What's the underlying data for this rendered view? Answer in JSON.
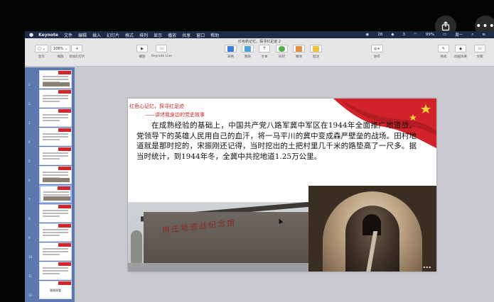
{
  "menubar": {
    "app_name": "Keynote",
    "items": [
      "文件",
      "编辑",
      "插入",
      "幻灯片",
      "格式",
      "排列",
      "显示",
      "播放",
      "共享",
      "窗口",
      "帮助"
    ],
    "status": {
      "count_a": "28",
      "count_b": "3",
      "battery": "99%",
      "user": "周一"
    }
  },
  "window": {
    "title": "红色新记忆，探寻红足迹 2"
  },
  "toolbar": {
    "left": [
      {
        "label": "显示",
        "btn": "▢ ⌄"
      },
      {
        "label": "缩放",
        "btn": "106% ⌄"
      },
      {
        "label": "添加幻灯片",
        "btn": "+"
      }
    ],
    "play": [
      {
        "label": "播放",
        "btn": "▶"
      },
      {
        "label": "Keynote Live",
        "btn": "▭"
      }
    ],
    "insert": [
      {
        "label": "表格",
        "color": "#3b7be0"
      },
      {
        "label": "图表",
        "color": "#4aa3df"
      },
      {
        "label": "文本",
        "btn": "T"
      },
      {
        "label": "形状",
        "color": "#55b04a"
      },
      {
        "label": "媒体",
        "color": "#e0903b"
      },
      {
        "label": "批注",
        "color": "#f2c23a"
      }
    ],
    "collab": {
      "label": "协作"
    },
    "right": [
      {
        "label": "格式"
      },
      {
        "label": "动画效果"
      },
      {
        "label": "文稿"
      }
    ]
  },
  "slide": {
    "title": "红色心记忆，探寻红足迹",
    "subtitle": "——讲述我身边的党史故事",
    "paragraph": "在成熟经验的基础上，中国共产党八路军冀中军区在1944年全面推广地道战。党领导下的英雄人民用自己的血汗，将一马平川的冀中变成森严壁垒的战场。田村地道就是那时挖的，宋振刚还记得，当时挖出的土把村里几千米的路垫高了一尺多。据当时统计，到1944年冬，全冀中共挖地道1.25万公里。",
    "wall_sign": "冉庄地道战纪念馆"
  },
  "sidebar": {
    "slides": [
      {
        "num": "1",
        "type": "image"
      },
      {
        "num": "2",
        "type": "text"
      },
      {
        "num": "3",
        "type": "text"
      },
      {
        "num": "4",
        "type": "text"
      },
      {
        "num": "5",
        "type": "text"
      },
      {
        "num": "6",
        "type": "image"
      },
      {
        "num": "7",
        "type": "image",
        "selected": true
      },
      {
        "num": "8",
        "type": "text"
      },
      {
        "num": "9",
        "type": "text"
      },
      {
        "num": "10",
        "type": "text"
      },
      {
        "num": "11",
        "type": "text"
      },
      {
        "num": "12",
        "type": "ending",
        "label": "谢谢观看"
      }
    ]
  }
}
